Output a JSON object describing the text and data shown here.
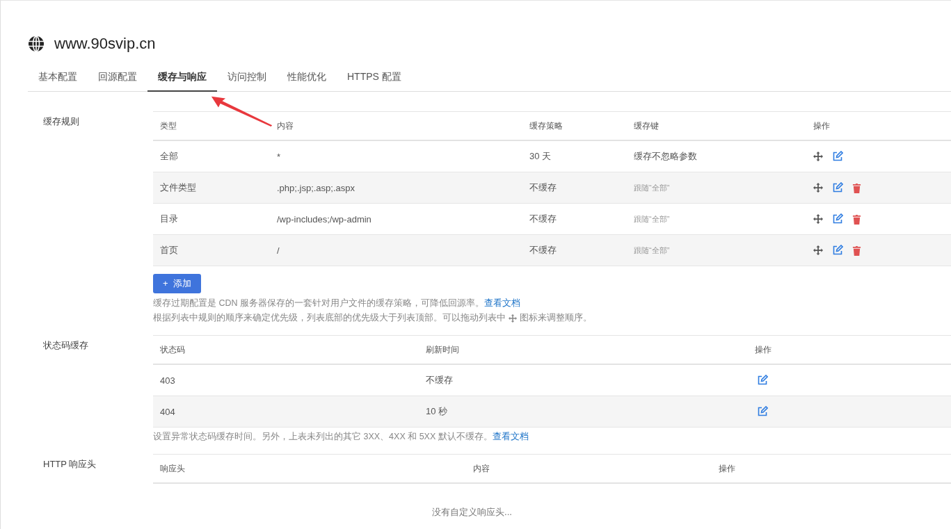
{
  "site": {
    "title": "www.90svip.cn"
  },
  "tabs": [
    {
      "label": "基本配置",
      "selected": false
    },
    {
      "label": "回源配置",
      "selected": false
    },
    {
      "label": "缓存与响应",
      "selected": true
    },
    {
      "label": "访问控制",
      "selected": false
    },
    {
      "label": "性能优化",
      "selected": false
    },
    {
      "label": "HTTPS 配置",
      "selected": false
    }
  ],
  "cache_rules": {
    "label": "缓存规则",
    "columns": [
      "类型",
      "内容",
      "缓存策略",
      "缓存键",
      "操作"
    ],
    "rows": [
      {
        "type": "全部",
        "content": "*",
        "policy": "30 天",
        "key": "缓存不忽略参数",
        "key_inherited": false,
        "deletable": false
      },
      {
        "type": "文件类型",
        "content": ".php;.jsp;.asp;.aspx",
        "policy": "不缓存",
        "key": "跟随“全部”",
        "key_inherited": true,
        "deletable": true
      },
      {
        "type": "目录",
        "content": "/wp-includes;/wp-admin",
        "policy": "不缓存",
        "key": "跟随“全部”",
        "key_inherited": true,
        "deletable": true
      },
      {
        "type": "首页",
        "content": "/",
        "policy": "不缓存",
        "key": "跟随“全部”",
        "key_inherited": true,
        "deletable": true
      }
    ],
    "add_button": {
      "icon": "+",
      "label": "添加"
    },
    "help_line_1": "缓存过期配置是 CDN 服务器保存的一套针对用户文件的缓存策略，可降低回源率。",
    "help_link": "查看文档",
    "help_line_2_before": "根据列表中规则的顺序来确定优先级，列表底部的优先级大于列表顶部。可以拖动列表中",
    "help_line_2_after": "图标来调整顺序。"
  },
  "status_code_cache": {
    "label": "状态码缓存",
    "columns": [
      "状态码",
      "刷新时间",
      "操作"
    ],
    "rows": [
      {
        "code": "403",
        "time": "不缓存"
      },
      {
        "code": "404",
        "time": "10 秒"
      }
    ],
    "help": "设置异常状态码缓存时间。另外，上表未列出的其它 3XX、4XX 和 5XX 默认不缓存。",
    "help_link": "查看文档"
  },
  "http_headers": {
    "label": "HTTP 响应头",
    "columns": [
      "响应头",
      "内容",
      "操作"
    ],
    "empty": "没有自定义响应头..."
  }
}
